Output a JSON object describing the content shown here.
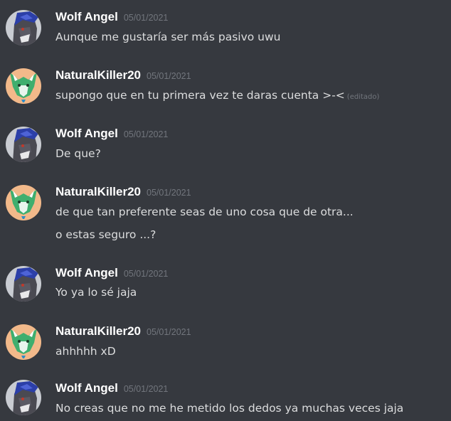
{
  "messages": [
    {
      "author": "Wolf Angel",
      "timestamp": "05/01/2021",
      "avatar": "wolf-avatar",
      "lines": [
        "Aunque me gustaría ser más pasivo uwu"
      ]
    },
    {
      "author": "NaturalKiller20",
      "timestamp": "05/01/2021",
      "avatar": "green-fox-avatar",
      "lines": [
        "supongo que en tu primera vez te daras cuenta >-<"
      ],
      "edited_label": "(editado)"
    },
    {
      "author": "Wolf Angel",
      "timestamp": "05/01/2021",
      "avatar": "wolf-avatar",
      "lines": [
        "De que?"
      ]
    },
    {
      "author": "NaturalKiller20",
      "timestamp": "05/01/2021",
      "avatar": "green-fox-avatar",
      "lines": [
        "de que tan preferente seas de uno cosa que de otra...",
        "o estas seguro ...?"
      ]
    },
    {
      "author": "Wolf Angel",
      "timestamp": "05/01/2021",
      "avatar": "wolf-avatar",
      "lines": [
        "Yo ya lo sé jaja"
      ]
    },
    {
      "author": "NaturalKiller20",
      "timestamp": "05/01/2021",
      "avatar": "green-fox-avatar",
      "lines": [
        "ahhhhh xD"
      ]
    },
    {
      "author": "Wolf Angel",
      "timestamp": "05/01/2021",
      "avatar": "wolf-avatar",
      "lines": [
        "No creas que no me he metido los dedos ya muchas veces jaja"
      ]
    }
  ],
  "colors": {
    "background": "#36393f",
    "username": "#ffffff",
    "message_text": "#dcddde",
    "timestamp": "#72767d"
  }
}
